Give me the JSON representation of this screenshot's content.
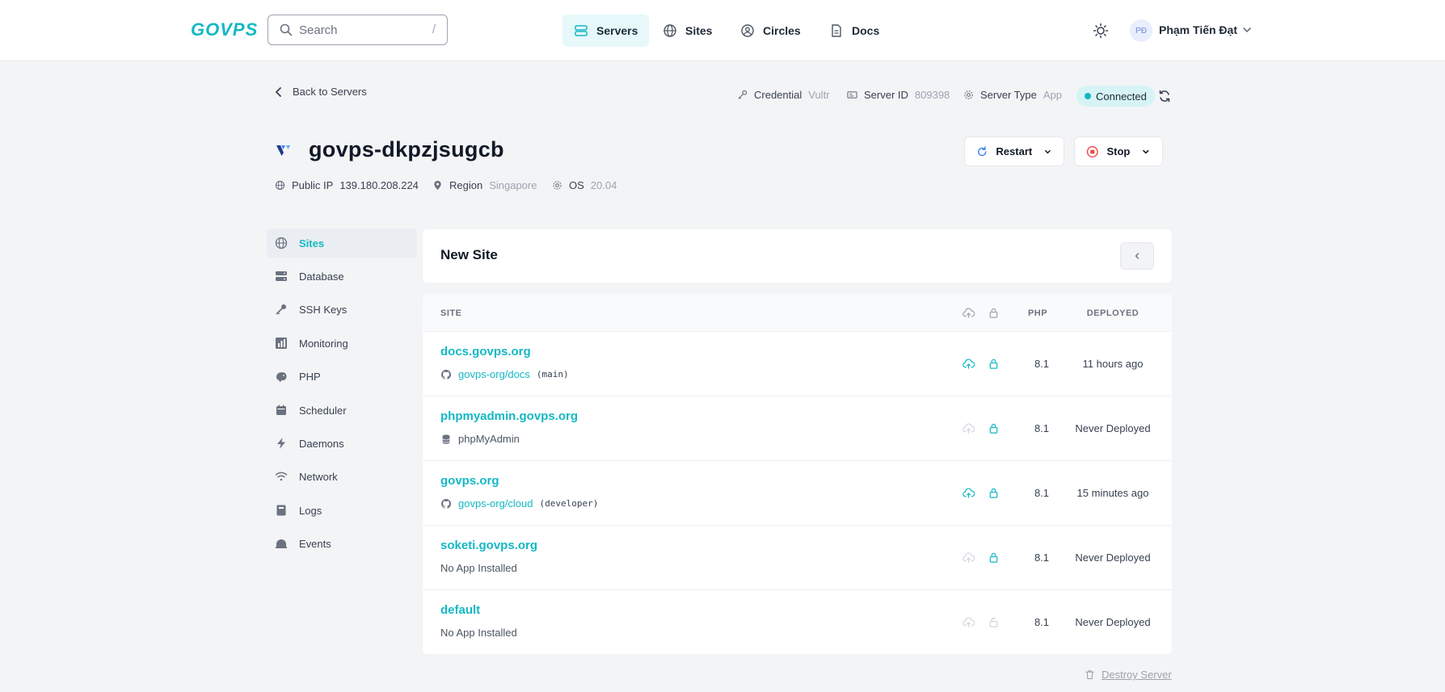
{
  "brand": {
    "logo": "GOVPS",
    "accent": "#14b8c4"
  },
  "search": {
    "placeholder": "Search",
    "shortcut": "/"
  },
  "nav": [
    {
      "label": "Servers",
      "icon": "server-icon",
      "active": true
    },
    {
      "label": "Sites",
      "icon": "globe-icon"
    },
    {
      "label": "Circles",
      "icon": "user-circle-icon"
    },
    {
      "label": "Docs",
      "icon": "document-icon"
    }
  ],
  "user": {
    "initials": "PĐ",
    "name": "Phạm Tiến Đạt"
  },
  "back": {
    "label": "Back to Servers"
  },
  "server_meta": {
    "credential_label": "Credential",
    "credential_value": "Vultr",
    "server_id_label": "Server ID",
    "server_id_value": "809398",
    "server_type_label": "Server Type",
    "server_type_value": "App",
    "status": "Connected"
  },
  "server": {
    "name": "govps-dkpzjsugcb",
    "public_ip_label": "Public IP",
    "public_ip_value": "139.180.208.224",
    "region_label": "Region",
    "region_value": "Singapore",
    "os_label": "OS",
    "os_value": "20.04"
  },
  "actions": {
    "restart": "Restart",
    "stop": "Stop"
  },
  "sidebar": [
    {
      "label": "Sites",
      "icon": "globe-icon",
      "active": true
    },
    {
      "label": "Database",
      "icon": "database-icon"
    },
    {
      "label": "SSH Keys",
      "icon": "key-icon"
    },
    {
      "label": "Monitoring",
      "icon": "chart-icon"
    },
    {
      "label": "PHP",
      "icon": "php-icon"
    },
    {
      "label": "Scheduler",
      "icon": "calendar-icon"
    },
    {
      "label": "Daemons",
      "icon": "bolt-icon"
    },
    {
      "label": "Network",
      "icon": "wifi-icon"
    },
    {
      "label": "Logs",
      "icon": "log-icon"
    },
    {
      "label": "Events",
      "icon": "events-icon"
    }
  ],
  "new_site": {
    "title": "New Site"
  },
  "table": {
    "headers": {
      "site": "SITE",
      "php": "PHP",
      "deployed": "DEPLOYED"
    },
    "rows": [
      {
        "name": "docs.govps.org",
        "sub_type": "repo",
        "repo": "govps-org/docs",
        "branch": "(main)",
        "php": "8.1",
        "deployed": "11 hours ago",
        "deploy_active": true,
        "ssl_active": true
      },
      {
        "name": "phpmyadmin.govps.org",
        "sub_type": "app",
        "app": "phpMyAdmin",
        "php": "8.1",
        "deployed": "Never Deployed",
        "deploy_active": false,
        "ssl_active": true
      },
      {
        "name": "govps.org",
        "sub_type": "repo",
        "repo": "govps-org/cloud",
        "branch": "(developer)",
        "php": "8.1",
        "deployed": "15 minutes ago",
        "deploy_active": true,
        "ssl_active": true
      },
      {
        "name": "soketi.govps.org",
        "sub_type": "none",
        "app": "No App Installed",
        "php": "8.1",
        "deployed": "Never Deployed",
        "deploy_active": false,
        "ssl_active": true
      },
      {
        "name": "default",
        "sub_type": "none",
        "app": "No App Installed",
        "php": "8.1",
        "deployed": "Never Deployed",
        "deploy_active": false,
        "ssl_active": false
      }
    ]
  },
  "destroy": {
    "label": "Destroy Server"
  }
}
